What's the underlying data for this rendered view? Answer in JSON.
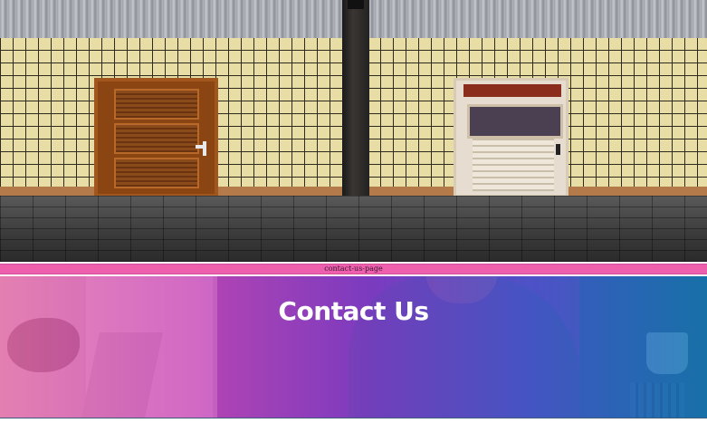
{
  "label_bar": {
    "text": "contact-us-page"
  },
  "contact_banner": {
    "title": "Contact Us"
  },
  "colors": {
    "label_bar": "#ee5fae",
    "overlay_left": "#e86caa",
    "overlay_right": "#1676b2",
    "title_text": "#ffffff"
  }
}
